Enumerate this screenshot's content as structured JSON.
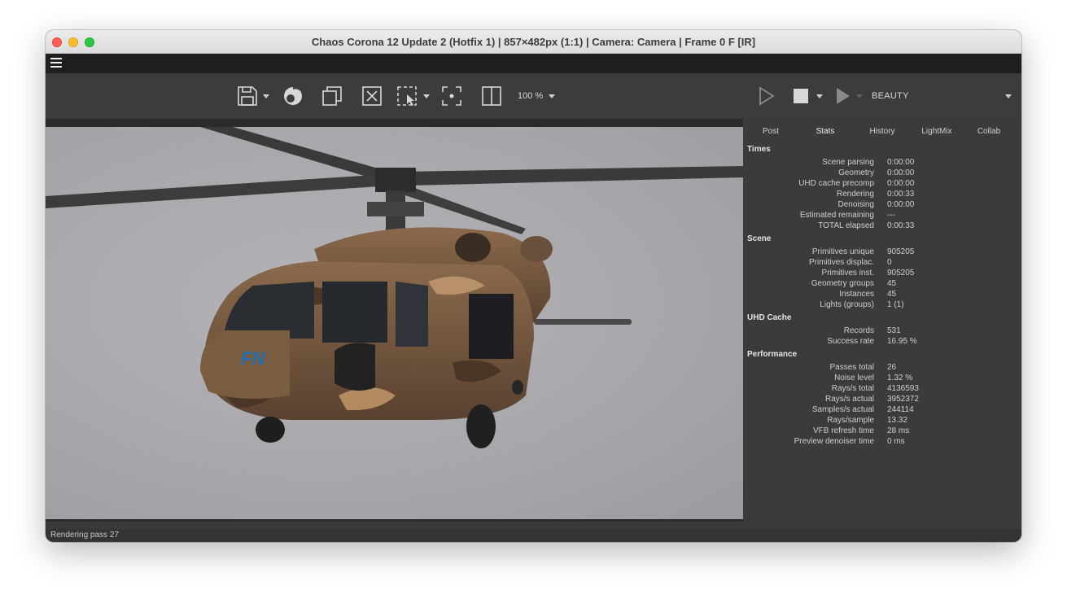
{
  "window": {
    "title": "Chaos Corona 12 Update 2 (Hotfix 1) | 857×482px (1:1) | Camera: Camera | Frame 0 F [IR]"
  },
  "toolbar": {
    "zoom_label": "100 %",
    "render_element": "BEAUTY",
    "icons": [
      "save-icon",
      "corona-logo-icon",
      "copy-icon",
      "clear-icon",
      "region-select-icon",
      "focus-icon",
      "split-view-icon",
      "play-icon",
      "stop-icon",
      "start-interactive-icon"
    ]
  },
  "render": {
    "subject_logo": "FN"
  },
  "tabs": [
    "Post",
    "Stats",
    "History",
    "LightMix",
    "Collab"
  ],
  "active_tab": "Stats",
  "stats": {
    "times": {
      "title": "Times",
      "rows": [
        {
          "label": "Scene parsing",
          "value": "0:00:00"
        },
        {
          "label": "Geometry",
          "value": "0:00:00"
        },
        {
          "label": "UHD cache precomp",
          "value": "0:00:00"
        },
        {
          "label": "Rendering",
          "value": "0:00:33"
        },
        {
          "label": "Denoising",
          "value": "0:00:00"
        },
        {
          "label": "Estimated remaining",
          "value": "---"
        },
        {
          "label": "TOTAL elapsed",
          "value": "0:00:33"
        }
      ]
    },
    "scene": {
      "title": "Scene",
      "rows": [
        {
          "label": "Primitives unique",
          "value": "905205"
        },
        {
          "label": "Primitives displac.",
          "value": "0"
        },
        {
          "label": "Primitives inst.",
          "value": "905205"
        },
        {
          "label": "Geometry groups",
          "value": "45"
        },
        {
          "label": "Instances",
          "value": "45"
        },
        {
          "label": "Lights (groups)",
          "value": "1 (1)"
        }
      ]
    },
    "uhd": {
      "title": "UHD Cache",
      "rows": [
        {
          "label": "Records",
          "value": "531"
        },
        {
          "label": "Success rate",
          "value": "16.95 %"
        }
      ]
    },
    "performance": {
      "title": "Performance",
      "rows": [
        {
          "label": "Passes total",
          "value": "26"
        },
        {
          "label": "Noise level",
          "value": "1.32 %"
        },
        {
          "label": "Rays/s total",
          "value": "4136593"
        },
        {
          "label": "Rays/s actual",
          "value": "3952372"
        },
        {
          "label": "Samples/s actual",
          "value": "244114"
        },
        {
          "label": "Rays/sample",
          "value": "13.32"
        },
        {
          "label": "VFB refresh time",
          "value": "28 ms"
        },
        {
          "label": "Preview denoiser time",
          "value": "0 ms"
        }
      ]
    }
  },
  "status": {
    "text": "Rendering pass 27"
  }
}
